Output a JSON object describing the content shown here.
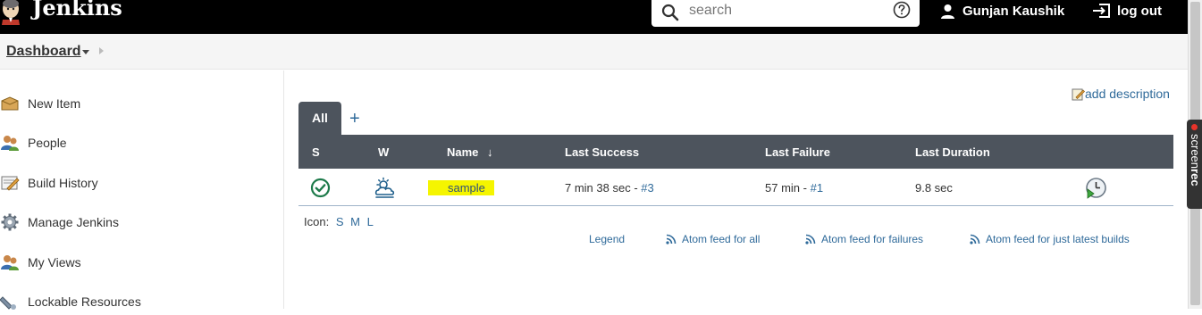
{
  "header": {
    "app_name": "Jenkins",
    "search_placeholder": "search",
    "user_name": "Gunjan Kaushik",
    "logout_label": "log out"
  },
  "breadcrumb": {
    "dashboard": "Dashboard"
  },
  "sidebar": {
    "items": [
      {
        "label": "New Item",
        "icon": "new-item-icon"
      },
      {
        "label": "People",
        "icon": "people-icon"
      },
      {
        "label": "Build History",
        "icon": "build-history-icon"
      },
      {
        "label": "Manage Jenkins",
        "icon": "gear-icon"
      },
      {
        "label": "My Views",
        "icon": "my-views-icon"
      },
      {
        "label": "Lockable Resources",
        "icon": "lockable-resources-icon"
      }
    ]
  },
  "main": {
    "add_description": "add description",
    "tabs": [
      {
        "label": "All"
      },
      {
        "label": "+"
      }
    ],
    "table": {
      "headers": {
        "s": "S",
        "w": "W",
        "name": "Name",
        "name_sort": "↓",
        "last_success": "Last Success",
        "last_failure": "Last Failure",
        "last_duration": "Last Duration"
      },
      "rows": [
        {
          "status_icon": "success-check-icon",
          "weather_icon": "cloudy-weather-icon",
          "name": "sample",
          "last_success_time": "7 min 38 sec -",
          "last_success_build": "#3",
          "last_failure_time": "57 min -",
          "last_failure_build": "#1",
          "last_duration": "9.8 sec",
          "action_icon": "schedule-build-icon"
        }
      ]
    },
    "icon_size": {
      "label": "Icon:",
      "sizes": [
        "S",
        "M",
        "L"
      ]
    },
    "footer": {
      "legend": "Legend",
      "atom_all": "Atom feed for all",
      "atom_failures": "Atom feed for failures",
      "atom_latest": "Atom feed for just latest builds"
    }
  },
  "overlay": {
    "screenrec_a": "screen",
    "screenrec_b": "rec"
  },
  "colors": {
    "header_bg": "#000000",
    "table_head_bg": "#4d545d",
    "link": "#2f6a9a",
    "highlight": "#f5f500",
    "success": "#1d7a4a"
  }
}
